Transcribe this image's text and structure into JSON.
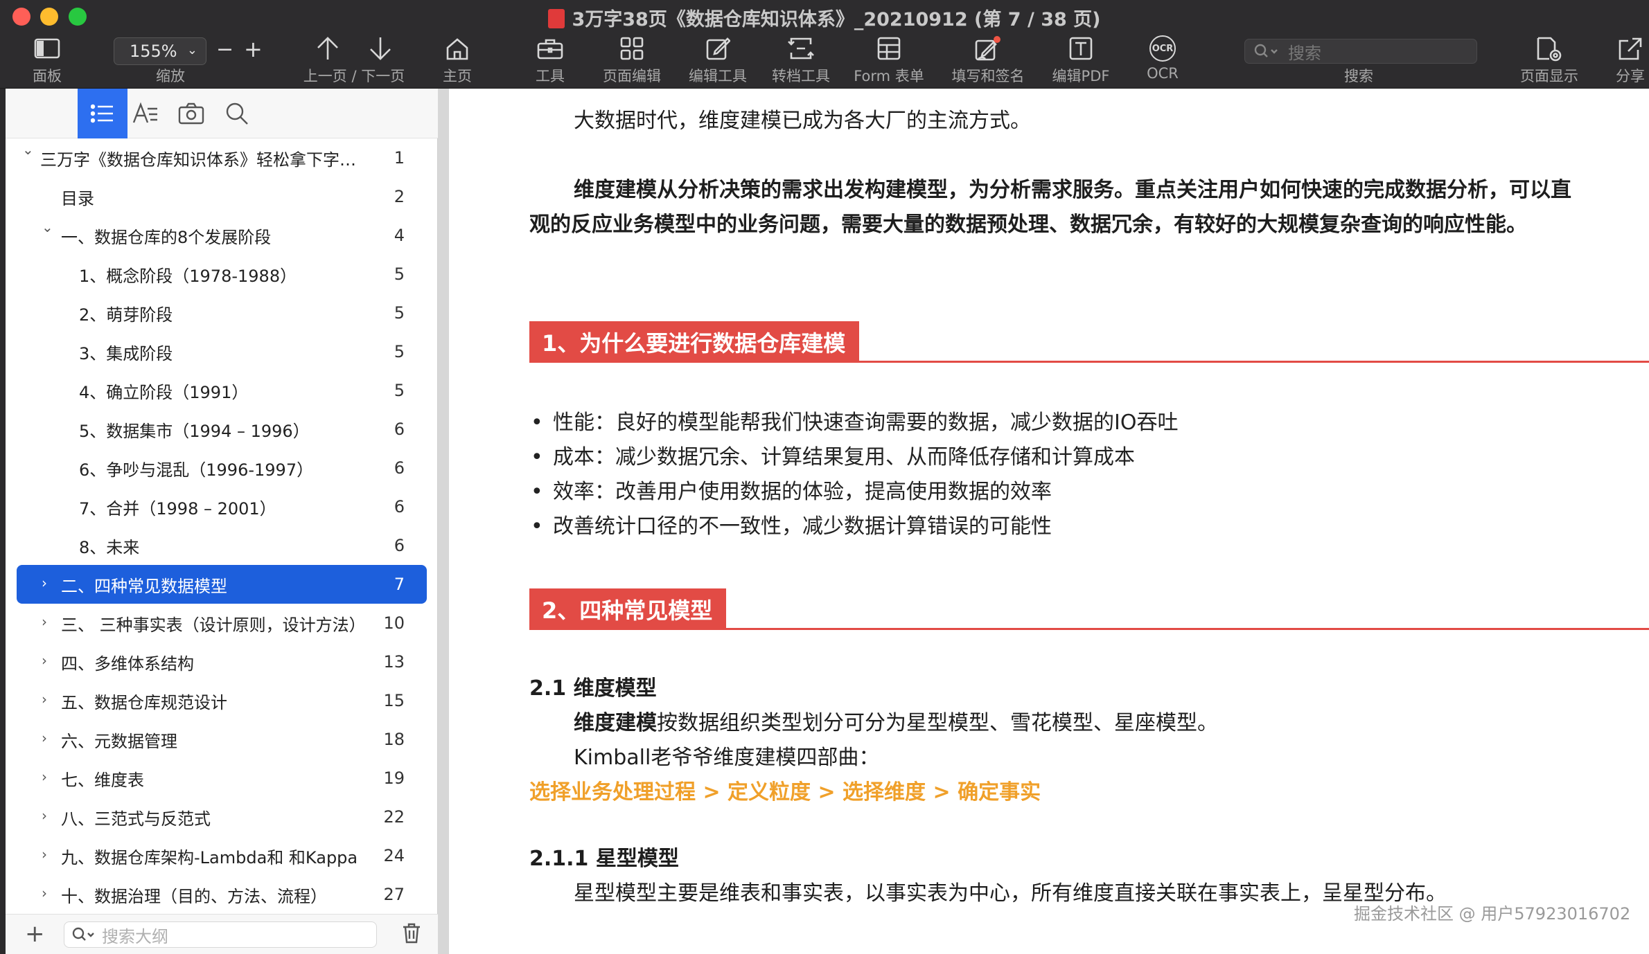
{
  "window": {
    "title": "3万字38页《数据仓库知识体系》_20210912 (第 7 / 38 页)"
  },
  "toolbar": {
    "panel": "面板",
    "zoom_value": "155%",
    "zoom_label": "缩放",
    "zoom_minus": "−",
    "zoom_plus": "+",
    "prev_next": "上一页 / 下一页",
    "home": "主页",
    "tools": "工具",
    "page_edit": "页面编辑",
    "edit_tools": "编辑工具",
    "convert": "转档工具",
    "form": "Form 表单",
    "fill_sign": "填写和签名",
    "edit_pdf": "编辑PDF",
    "ocr": "OCR",
    "ocr_glyph": "OCR",
    "search_placeholder": "搜索",
    "search_label": "搜索",
    "page_display": "页面显示",
    "share": "分享"
  },
  "sidebar": {
    "search_placeholder": "搜索大纲",
    "add": "+",
    "outline": [
      {
        "title": "三万字《数据仓库知识体系》轻松拿下字节 ...",
        "page": "1",
        "indent": 0,
        "disclosure": "⌄"
      },
      {
        "title": "目录",
        "page": "2",
        "indent": 1,
        "disclosure": ""
      },
      {
        "title": "一、数据仓库的8个发展阶段",
        "page": "4",
        "indent": 1,
        "disclosure": "⌄"
      },
      {
        "title": "1、概念阶段（1978-1988）",
        "page": "5",
        "indent": 2,
        "disclosure": ""
      },
      {
        "title": "2、萌芽阶段",
        "page": "5",
        "indent": 2,
        "disclosure": ""
      },
      {
        "title": "3、集成阶段",
        "page": "5",
        "indent": 2,
        "disclosure": ""
      },
      {
        "title": "4、确立阶段（1991）",
        "page": "5",
        "indent": 2,
        "disclosure": ""
      },
      {
        "title": "5、数据集市（1994 – 1996）",
        "page": "6",
        "indent": 2,
        "disclosure": ""
      },
      {
        "title": "6、争吵与混乱（1996-1997）",
        "page": "6",
        "indent": 2,
        "disclosure": ""
      },
      {
        "title": "7、合并（1998 – 2001）",
        "page": "6",
        "indent": 2,
        "disclosure": ""
      },
      {
        "title": "8、未来",
        "page": "6",
        "indent": 2,
        "disclosure": ""
      },
      {
        "title": "二、四种常见数据模型",
        "page": "7",
        "indent": 1,
        "disclosure": "›",
        "selected": true
      },
      {
        "title": "三、 三种事实表（设计原则，设计方法）",
        "page": "10",
        "indent": 1,
        "disclosure": "›"
      },
      {
        "title": "四、多维体系结构",
        "page": "13",
        "indent": 1,
        "disclosure": "›"
      },
      {
        "title": "五、数据仓库规范设计",
        "page": "15",
        "indent": 1,
        "disclosure": "›"
      },
      {
        "title": "六、元数据管理",
        "page": "18",
        "indent": 1,
        "disclosure": "›"
      },
      {
        "title": "七、维度表",
        "page": "19",
        "indent": 1,
        "disclosure": "›"
      },
      {
        "title": "八、三范式与反范式",
        "page": "22",
        "indent": 1,
        "disclosure": "›"
      },
      {
        "title": "九、数据仓库架构-Lambda和 和Kappa",
        "page": "24",
        "indent": 1,
        "disclosure": "›"
      },
      {
        "title": "十、数据治理（目的、方法、流程）",
        "page": "27",
        "indent": 1,
        "disclosure": "›"
      }
    ]
  },
  "document": {
    "line1": "大数据时代，维度建模已成为各大厂的主流方式。",
    "para1_a": "维度建模从分析决策的需求出发构建模型，为分析需求服务。重点关注用户如何快速的完成数据分析，可以直",
    "para1_b": "观的反应业务模型中的业务问题，需要大量的数据预处理、数据冗余，有较好的大规模复杂查询的响应性能。",
    "section1": "1、为什么要进行数据仓库建模",
    "bullets": [
      "性能：良好的模型能帮我们快速查询需要的数据，减少数据的IO吞吐",
      "成本：减少数据冗余、计算结果复用、从而降低存储和计算成本",
      "效率：改善用户使用数据的体验，提高使用数据的效率",
      "改善统计口径的不一致性，减少数据计算错误的可能性"
    ],
    "section2": "2、四种常见模型",
    "h21": "2.1 维度模型",
    "p21_bold": "维度建模",
    "p21_rest": "按数据组织类型划分可分为星型模型、雪花模型、星座模型。",
    "kimball": "Kimball老爷爷维度建模四部曲：",
    "steps": "选择业务处理过程 > 定义粒度 > 选择维度 > 确定事实",
    "h211": "2.1.1 星型模型",
    "p211": "星型模型主要是维表和事实表，以事实表为中心，所有维度直接关联在事实表上，呈星型分布。",
    "watermark": "掘金技术社区 @ 用户57923016702"
  },
  "colors": {
    "accent": "#1d5fdc",
    "section": "#e24b45",
    "highlight": "#f0a02a"
  }
}
